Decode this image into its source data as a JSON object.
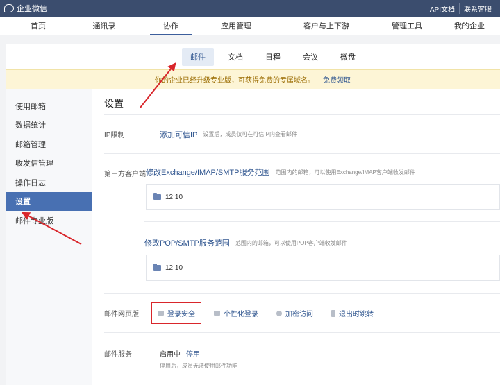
{
  "topbar": {
    "brand": "企业微信",
    "links": [
      "API文档",
      "联系客服"
    ]
  },
  "main_nav": {
    "items": [
      "首页",
      "通讯录",
      "协作",
      "应用管理",
      "客户与上下游",
      "管理工具",
      "我的企业"
    ],
    "active_index": 2
  },
  "sub_nav": {
    "items": [
      "邮件",
      "文档",
      "日程",
      "会议",
      "微盘"
    ],
    "active_index": 0
  },
  "notice": {
    "text": "你的企业已经升级专业版，可获得免费的专属域名。",
    "link": "免费领取"
  },
  "sidebar": {
    "items": [
      "使用邮箱",
      "数据统计",
      "邮箱管理",
      "收发信管理",
      "操作日志",
      "设置",
      "邮件专业版"
    ],
    "active_index": 5
  },
  "content": {
    "title": "设置",
    "ip": {
      "label": "IP限制",
      "link": "添加可信IP",
      "hint": "设置后，成员仅可在可信IP内查看邮件"
    },
    "third_party": {
      "label": "第三方客户端",
      "exchange_link": "修改Exchange/IMAP/SMTP服务范围",
      "exchange_hint": "范围内的邮箱，可以使用Exchange/IMAP客户端收发邮件",
      "exchange_folder": "12.10",
      "pop_link": "修改POP/SMTP服务范围",
      "pop_hint": "范围内的邮箱，可以使用POP客户端收发邮件",
      "pop_folder": "12.10"
    },
    "web": {
      "label": "邮件网页版",
      "tabs": [
        "登录安全",
        "个性化登录",
        "加密访问",
        "退出时跳转"
      ]
    },
    "service": {
      "label": "邮件服务",
      "status": "启用中",
      "action": "停用",
      "hint": "停用后，成员无法使用邮件功能"
    }
  },
  "colors": {
    "topbar": "#3b4d6e",
    "accent": "#4870b2",
    "link": "#2f558f",
    "annotation": "#d9262b"
  }
}
